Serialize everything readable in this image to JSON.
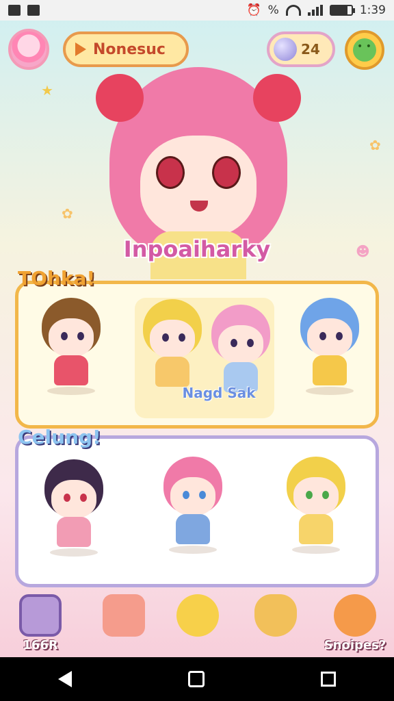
{
  "status_bar": {
    "battery": "%",
    "battery_level": 0.8,
    "time": "1:39"
  },
  "hud": {
    "quest_label": "Nonesuc",
    "coins": "24"
  },
  "hero": {
    "name": "Inpoaiharky"
  },
  "panel_1": {
    "title": "TOhka!",
    "featured_label": "Nagd Sak"
  },
  "panel_2": {
    "title": "Celung!"
  },
  "dock": {
    "items": [
      {
        "label": "166R"
      },
      {
        "label": ""
      },
      {
        "label": ""
      },
      {
        "label": ""
      },
      {
        "label": "Snoipes?"
      }
    ]
  },
  "colors": {
    "panel1_border": "#f2b74a",
    "panel2_border": "#b7a7de",
    "accent_pink": "#f07aa8"
  }
}
